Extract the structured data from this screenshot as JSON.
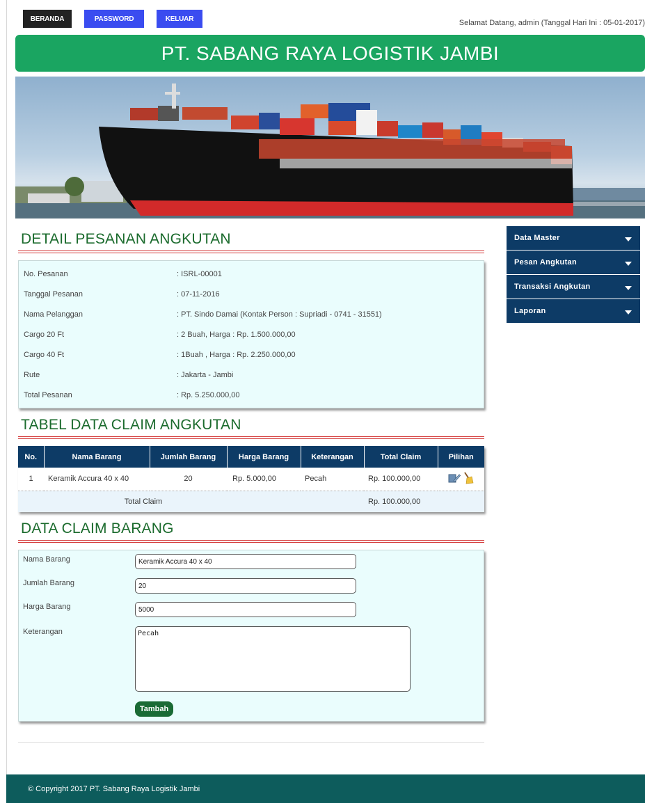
{
  "nav": {
    "home": "BERANDA",
    "password": "PASSWORD",
    "logout": "KELUAR"
  },
  "welcome": "Selamat Datang, admin (Tanggal Hari Ini : 05-01-2017)",
  "site_title": "PT. SABANG RAYA LOGISTIK JAMBI",
  "detail": {
    "title": "DETAIL PESANAN ANGKUTAN",
    "rows": [
      {
        "label": "No. Pesanan",
        "value": ": ISRL-00001"
      },
      {
        "label": "Tanggal Pesanan",
        "value": ": 07-11-2016"
      },
      {
        "label": "Nama Pelanggan",
        "value": ": PT. Sindo Damai (Kontak Person : Supriadi - 0741 - 31551)"
      },
      {
        "label": "Cargo 20 Ft",
        "value": ": 2 Buah, Harga : Rp. 1.500.000,00"
      },
      {
        "label": "Cargo 40 Ft",
        "value": ": 1Buah , Harga : Rp. 2.250.000,00"
      },
      {
        "label": "Rute",
        "value": ": Jakarta - Jambi"
      },
      {
        "label": "Total Pesanan",
        "value": ": Rp. 5.250.000,00"
      }
    ]
  },
  "claim_table": {
    "title": "TABEL DATA CLAIM ANGKUTAN",
    "headers": [
      "No.",
      "Nama Barang",
      "Jumlah Barang",
      "Harga Barang",
      "Keterangan",
      "Total Claim",
      "Pilihan"
    ],
    "rows": [
      {
        "no": "1",
        "nama": "Keramik Accura 40 x 40",
        "jumlah": "20",
        "harga": "Rp. 5.000,00",
        "ket": "Pecah",
        "total": "Rp. 100.000,00"
      }
    ],
    "footer_label": "Total Claim",
    "footer_total": "Rp. 100.000,00",
    "icons": [
      "edit-icon",
      "broom-icon"
    ]
  },
  "claim_form": {
    "title": "DATA CLAIM BARANG",
    "nama_label": "Nama Barang",
    "nama_value": "Keramik Accura 40 x 40",
    "jumlah_label": "Jumlah Barang",
    "jumlah_value": "20",
    "harga_label": "Harga Barang",
    "harga_value": "5000",
    "ket_label": "Keterangan",
    "ket_value": "Pecah",
    "submit": "Tambah"
  },
  "sidebar": {
    "items": [
      {
        "label": "Data Master"
      },
      {
        "label": "Pesan Angkutan"
      },
      {
        "label": "Transaksi Angkutan"
      },
      {
        "label": "Laporan"
      }
    ]
  },
  "footer": "© Copyright 2017 PT. Sabang Raya Logistik Jambi",
  "colors": {
    "title_green": "#1aa561",
    "navy": "#0d3b66",
    "footer_teal": "#0d5c5c",
    "button_blue": "#3a4cf0",
    "section_text": "#1b6b2d",
    "panel_bg": "#eafdfd"
  }
}
